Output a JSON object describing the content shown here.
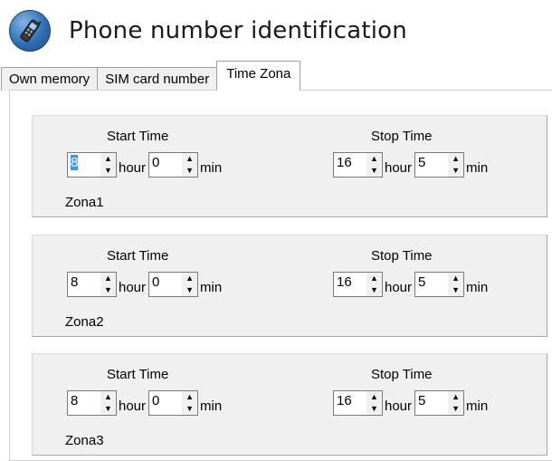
{
  "window": {
    "title": "Phone number identification",
    "icon": "mobile-phone-icon"
  },
  "tabs": [
    {
      "label": "Own memory",
      "active": false
    },
    {
      "label": "SIM card number",
      "active": false
    },
    {
      "label": "Time Zona",
      "active": true
    }
  ],
  "labels": {
    "start_time": "Start Time",
    "stop_time": "Stop Time",
    "hour": "hour",
    "min": "min"
  },
  "zones": [
    {
      "name": "Zona1",
      "start_hour": "8",
      "start_min": "0",
      "stop_hour": "16",
      "stop_min": "5"
    },
    {
      "name": "Zona2",
      "start_hour": "8",
      "start_min": "0",
      "stop_hour": "16",
      "stop_min": "5"
    },
    {
      "name": "Zona3",
      "start_hour": "8",
      "start_min": "0",
      "stop_hour": "16",
      "stop_min": "5"
    }
  ],
  "selection": {
    "zone": "Zona1",
    "field": "start_hour"
  },
  "colors": {
    "selection": "#3399ff",
    "panel": "#f0f0f0"
  }
}
